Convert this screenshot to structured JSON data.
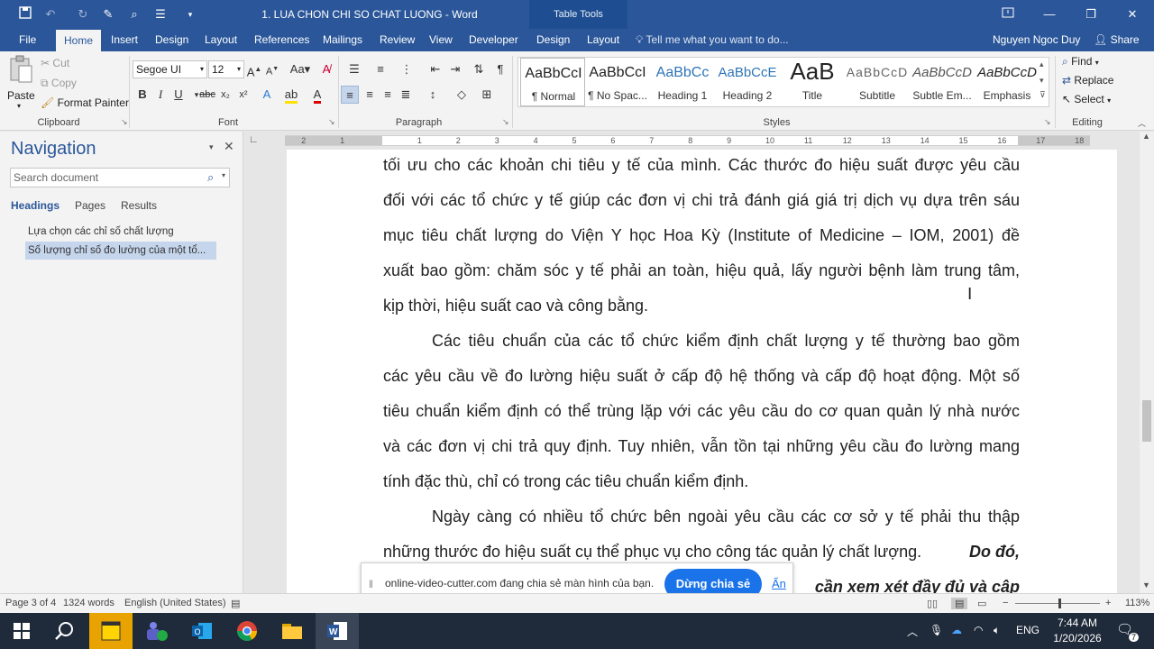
{
  "window": {
    "title": "1. LUA CHON CHI SO CHAT LUONG  -  Word",
    "contextual_tab_group": "Table Tools"
  },
  "tabs": [
    "File",
    "Home",
    "Insert",
    "Design",
    "Layout",
    "References",
    "Mailings",
    "Review",
    "View",
    "Developer",
    "Design",
    "Layout"
  ],
  "active_tab": "Home",
  "tell_me": "Tell me what you want to do...",
  "user": "Nguyen Ngoc Duy",
  "share_label": "Share",
  "ribbon": {
    "clipboard": {
      "paste": "Paste",
      "cut": "Cut",
      "copy": "Copy",
      "format_painter": "Format Painter",
      "label": "Clipboard"
    },
    "font": {
      "font_name": "Segoe UI",
      "font_size": "12",
      "label": "Font"
    },
    "paragraph": {
      "label": "Paragraph"
    },
    "styles": {
      "label": "Styles",
      "items": [
        {
          "preview": "AaBbCcI",
          "name": "¶ Normal"
        },
        {
          "preview": "AaBbCcI",
          "name": "¶ No Spac..."
        },
        {
          "preview": "AaBbCc",
          "name": "Heading 1"
        },
        {
          "preview": "AaBbCcE",
          "name": "Heading 2"
        },
        {
          "preview": "AaB",
          "name": "Title"
        },
        {
          "preview": "AaBbCcD",
          "name": "Subtitle"
        },
        {
          "preview": "AaBbCcD",
          "name": "Subtle Em..."
        },
        {
          "preview": "AaBbCcD",
          "name": "Emphasis"
        }
      ]
    },
    "editing": {
      "find": "Find",
      "replace": "Replace",
      "select": "Select",
      "label": "Editing"
    }
  },
  "navigation": {
    "title": "Navigation",
    "search_placeholder": "Search document",
    "tabs": [
      "Headings",
      "Pages",
      "Results"
    ],
    "headings": [
      "Lựa chọn các chỉ số chất lượng",
      "Số lượng chỉ số đo lường của một tổ..."
    ]
  },
  "ruler_ticks": [
    "2",
    "1",
    "1",
    "2",
    "3",
    "4",
    "5",
    "6",
    "7",
    "8",
    "9",
    "10",
    "11",
    "12",
    "13",
    "14",
    "15",
    "16",
    "17",
    "18"
  ],
  "document": {
    "lines": [
      "tối ưu cho các khoản chi tiêu y tế của mình. Các thước đo hiệu suất được yêu cầu",
      "đối với các tổ chức y tế giúp các đơn vị chi trả đánh giá giá trị dịch vụ dựa trên sáu",
      "mục tiêu chất lượng do Viện Y học Hoa Kỳ (Institute of Medicine – IOM, 2001) đề",
      "xuất bao gồm: chăm sóc y tế phải an toàn, hiệu quả, lấy người bệnh làm trung tâm,",
      "kịp thời, hiệu suất cao và công bằng.",
      "Các tiêu chuẩn của các tổ chức kiểm định chất lượng y tế thường bao gồm",
      "các yêu cầu về đo lường hiệu suất ở cấp độ hệ thống và cấp độ hoạt động. Một số",
      "tiêu chuẩn kiểm định có thể trùng lặp với các yêu cầu do cơ quan quản lý nhà nước",
      "và các đơn vị chi trả quy định. Tuy nhiên, vẫn tồn tại những yêu cầu đo lường mang",
      "tính đặc thù, chỉ có trong các tiêu chuẩn kiểm định.",
      "Ngày càng có nhiều tổ chức bên ngoài yêu cầu các cơ sở y tế phải thu thập",
      "những thước đo hiệu suất cụ thể phục vụ cho công tác quản lý chất lượng."
    ],
    "bold_italic_fragment": "Do đó,",
    "partial_last_line": "cần xem xét đầy đủ và cập"
  },
  "sharing_bar": {
    "message": "online-video-cutter.com đang chia sẻ màn hình của bạn.",
    "stop_button": "Dừng chia sẻ",
    "hide_link": "Ẩn"
  },
  "status_bar": {
    "page": "Page 3 of 4",
    "words": "1324 words",
    "language": "English (United States)",
    "zoom": "113%"
  },
  "taskbar": {
    "language": "ENG",
    "time": "7:44 AM",
    "date": "1/20/2026",
    "notification_count": "7"
  }
}
